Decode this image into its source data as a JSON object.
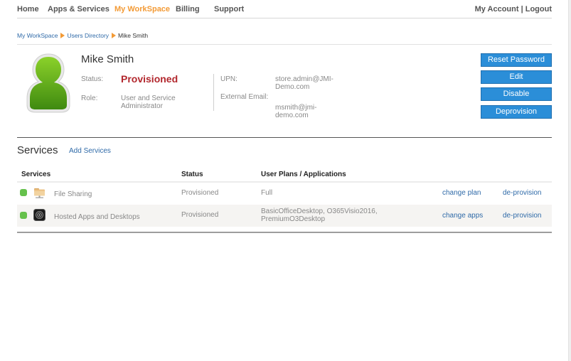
{
  "nav": {
    "items": [
      {
        "label": "Home",
        "active": false
      },
      {
        "label": "Apps & Services",
        "active": false
      },
      {
        "label": "My WorkSpace",
        "active": true
      },
      {
        "label": "Billing",
        "active": false
      },
      {
        "label": "Support",
        "active": false
      }
    ],
    "my_account": "My Account",
    "separator": " | ",
    "logout": "Logout"
  },
  "breadcrumb": [
    {
      "label": "My WorkSpace",
      "link": true
    },
    {
      "label": "Users Directory",
      "link": true
    },
    {
      "label": "Mike Smith",
      "link": false
    }
  ],
  "user": {
    "name": "Mike Smith",
    "avatar_icon": "user-avatar-icon",
    "status_label": "Status:",
    "status_value": "Provisioned",
    "role_label": "Role:",
    "role_value_line1": "User and Service",
    "role_value_line2": "Administrator",
    "upn_label": "UPN:",
    "upn_value_line1": "store.admin@JMI-",
    "upn_value_line2": "Demo.com",
    "external_email_label": "External Email:",
    "external_email_line1": "msmith@jmi-",
    "external_email_line2": "demo.com"
  },
  "actions": {
    "reset_password": "Reset Password",
    "edit": "Edit",
    "disable": "Disable",
    "deprovision": "Deprovision"
  },
  "services": {
    "title": "Services",
    "add_label": "Add Services",
    "columns": {
      "service": "Services",
      "status": "Status",
      "plans": "User Plans / Applications"
    },
    "rows": [
      {
        "icon": "folder-icon",
        "name": "File Sharing",
        "status": "Provisioned",
        "plans_line1": "Full",
        "plans_line2": "",
        "change_label": "change plan",
        "deprovision_label": "de-provision",
        "status_color": "#66c14c"
      },
      {
        "icon": "hosted-apps-icon",
        "name": "Hosted Apps and Desktops",
        "status": "Provisioned",
        "plans_line1": "BasicOfficeDesktop, O365Visio2016,",
        "plans_line2": "PremiumO3Desktop",
        "change_label": "change apps",
        "deprovision_label": "de-provision",
        "status_color": "#66c14c"
      }
    ]
  },
  "colors": {
    "accent_orange": "#f39a35",
    "button_blue": "#2b8ed8",
    "link_blue": "#2f6aa8",
    "status_red": "#b2272d",
    "status_green": "#66c14c"
  }
}
